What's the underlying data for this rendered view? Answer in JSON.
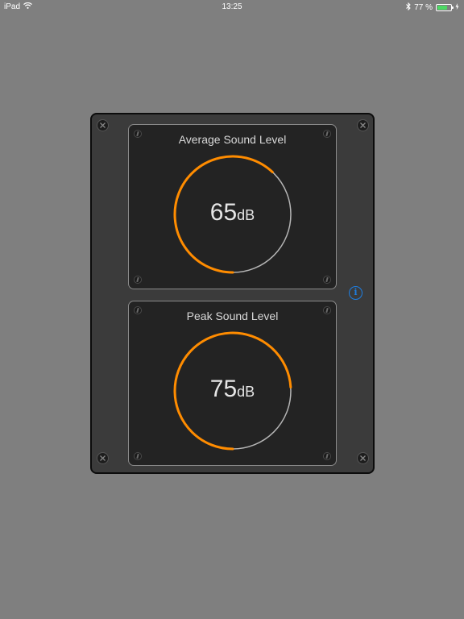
{
  "status_bar": {
    "device": "iPad",
    "time": "13:25",
    "battery_percent": "77 %",
    "battery_level": 0.77
  },
  "meters": [
    {
      "title": "Average Sound Level",
      "value": "65",
      "unit": "dB",
      "arc_fraction": 0.62
    },
    {
      "title": "Peak Sound Level",
      "value": "75",
      "unit": "dB",
      "arc_fraction": 0.74
    }
  ],
  "colors": {
    "accent": "#ff8c00",
    "track": "#b5b5b5",
    "info": "#1e7ee0"
  },
  "icons": {
    "info": "info-icon",
    "wifi": "wifi-icon",
    "bluetooth": "bluetooth-icon"
  }
}
